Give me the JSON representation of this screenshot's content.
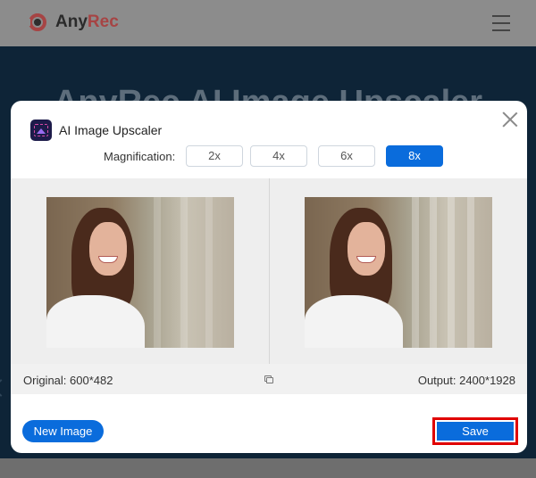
{
  "site": {
    "logo_any": "Any",
    "logo_rec": "Rec",
    "hero_title": "AnyRec AI Image Upscaler"
  },
  "dialog": {
    "title": "AI Image Upscaler",
    "magnification_label": "Magnification:",
    "magnification_options": [
      "2x",
      "4x",
      "6x",
      "8x"
    ],
    "selected_magnification": "8x",
    "original_label": "Original: 600*482",
    "output_label": "Output: 2400*1928",
    "new_image_label": "New Image",
    "save_label": "Save"
  },
  "colors": {
    "accent": "#0a6cdc",
    "highlight": "#e00000",
    "hero_bg": "#0e2437"
  },
  "icons": [
    "anyrec-logo-icon",
    "menu-icon",
    "close-icon",
    "app-icon",
    "compare-icon"
  ]
}
